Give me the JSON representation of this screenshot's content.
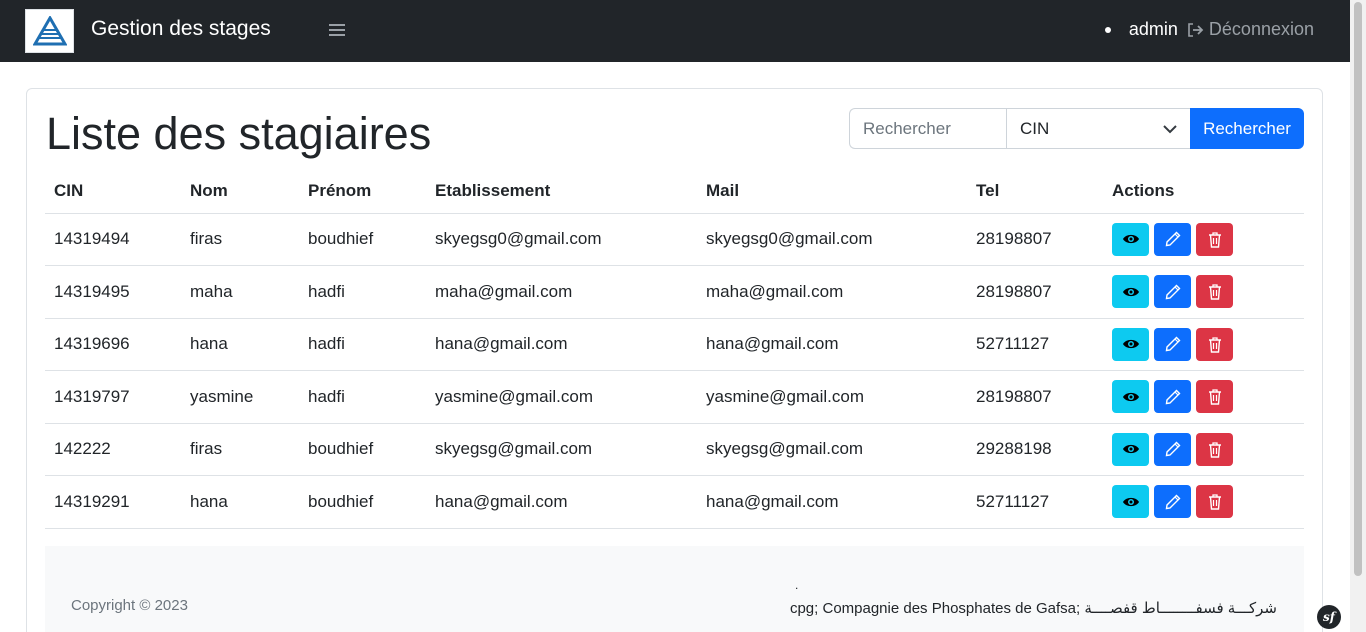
{
  "header": {
    "brand": "Gestion des stages",
    "username": "admin",
    "logout_label": "Déconnexion"
  },
  "page": {
    "title": "Liste des stagiaires"
  },
  "search": {
    "placeholder": "Rechercher",
    "selected_field": "CIN",
    "button_label": "Rechercher"
  },
  "table": {
    "columns": [
      "CIN",
      "Nom",
      "Prénom",
      "Etablissement",
      "Mail",
      "Tel",
      "Actions"
    ],
    "rows": [
      {
        "cin": "14319494",
        "nom": "firas",
        "prenom": "boudhief",
        "etablissement": "skyegsg0@gmail.com",
        "mail": "skyegsg0@gmail.com",
        "tel": "28198807"
      },
      {
        "cin": "14319495",
        "nom": "maha",
        "prenom": "hadfi",
        "etablissement": "maha@gmail.com",
        "mail": "maha@gmail.com",
        "tel": "28198807"
      },
      {
        "cin": "14319696",
        "nom": "hana",
        "prenom": "hadfi",
        "etablissement": "hana@gmail.com",
        "mail": "hana@gmail.com",
        "tel": "52711127"
      },
      {
        "cin": "14319797",
        "nom": "yasmine",
        "prenom": "hadfi",
        "etablissement": "yasmine@gmail.com",
        "mail": "yasmine@gmail.com",
        "tel": "28198807"
      },
      {
        "cin": "142222",
        "nom": "firas",
        "prenom": "boudhief",
        "etablissement": "skyegsg@gmail.com",
        "mail": "skyegsg@gmail.com",
        "tel": "29288198"
      },
      {
        "cin": "14319291",
        "nom": "hana",
        "prenom": "boudhief",
        "etablissement": "hana@gmail.com",
        "mail": "hana@gmail.com",
        "tel": "52711127"
      }
    ]
  },
  "footer": {
    "copyright": "Copyright © 2023",
    "dot": ".",
    "company": "cpg; Compagnie des Phosphates de Gafsa; شركـــة فسفــــــــاط قفصــــة"
  },
  "icons": {
    "logo": "company-logo",
    "menu": "hamburger-icon",
    "logout": "logout-icon",
    "view": "eye-icon",
    "edit": "pencil-icon",
    "delete": "trash-icon",
    "toolbar": "symfony-icon"
  },
  "colors": {
    "navbar": "#212529",
    "primary": "#0d6efd",
    "info": "#0dcaf0",
    "danger": "#dc3545"
  }
}
